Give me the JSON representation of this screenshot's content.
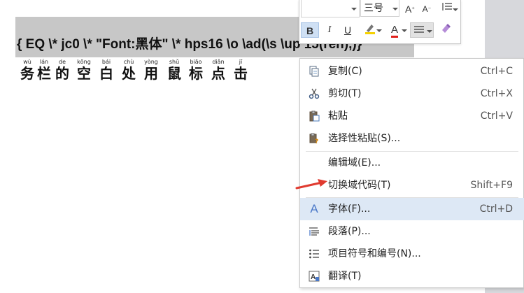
{
  "document": {
    "field_code": "{ EQ \\* jc0 \\* \"Font:黑体\" \\* hps16 \\o \\ad(\\s \\up 15(rén),)}",
    "ruby_text": [
      {
        "pinyin": "wù",
        "hanzi": "务"
      },
      {
        "pinyin": "lán",
        "hanzi": "栏"
      },
      {
        "pinyin": "de",
        "hanzi": "的"
      },
      {
        "pinyin": "kōng",
        "hanzi": "空"
      },
      {
        "pinyin": "bái",
        "hanzi": "白"
      },
      {
        "pinyin": "chù",
        "hanzi": "处"
      },
      {
        "pinyin": "yòng",
        "hanzi": "用"
      },
      {
        "pinyin": "shǔ",
        "hanzi": "鼠"
      },
      {
        "pinyin": "biāo",
        "hanzi": "标"
      },
      {
        "pinyin": "diǎn",
        "hanzi": "点"
      },
      {
        "pinyin": "jī",
        "hanzi": "击"
      }
    ]
  },
  "mini_toolbar": {
    "font_name": "",
    "font_size": "三号",
    "bold": "B",
    "italic": "I",
    "underline": "U",
    "font_color_glyph": "A",
    "grow_glyph": "A",
    "shrink_glyph": "A",
    "highlight_color": "#f5d100",
    "font_color": "#e0201b"
  },
  "context_menu": {
    "items": [
      {
        "icon": "copy-icon",
        "label": "复制(C)",
        "shortcut": "Ctrl+C"
      },
      {
        "icon": "scissors-icon",
        "label": "剪切(T)",
        "shortcut": "Ctrl+X"
      },
      {
        "icon": "paste-icon",
        "label": "粘贴",
        "shortcut": "Ctrl+V"
      },
      {
        "icon": "paste-special-icon",
        "label": "选择性粘贴(S)...",
        "shortcut": ""
      },
      {
        "icon": "",
        "label": "编辑域(E)...",
        "shortcut": ""
      },
      {
        "icon": "",
        "label": "切换域代码(T)",
        "shortcut": "Shift+F9"
      },
      {
        "icon": "font-icon",
        "label": "字体(F)...",
        "shortcut": "Ctrl+D"
      },
      {
        "icon": "paragraph-icon",
        "label": "段落(P)...",
        "shortcut": ""
      },
      {
        "icon": "bullets-icon",
        "label": "项目符号和编号(N)...",
        "shortcut": ""
      },
      {
        "icon": "translate-icon",
        "label": "翻译(T)",
        "shortcut": ""
      }
    ]
  },
  "annotation": {
    "arrow_color": "#e03a2f",
    "arrow_target": "切换域代码(T)"
  }
}
